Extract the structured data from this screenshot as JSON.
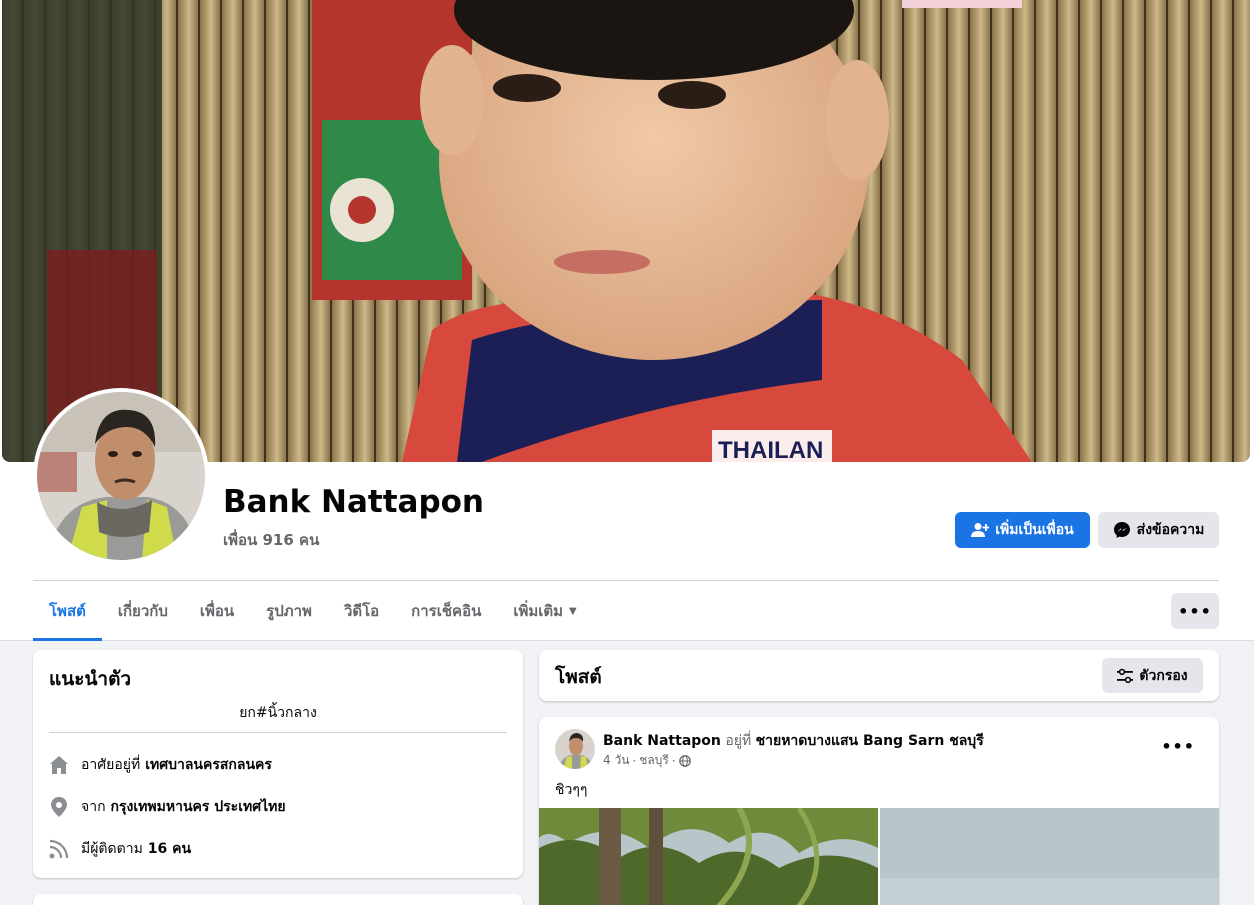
{
  "profile": {
    "name": "Bank Nattapon",
    "friends": "เพื่อน 916 คน",
    "cover_shirt_text": "THAILAN"
  },
  "actions": {
    "add_friend": "เพิ่มเป็นเพื่อน",
    "message": "ส่งข้อความ"
  },
  "tabs": [
    {
      "label": "โพสต์",
      "active": true
    },
    {
      "label": "เกี่ยวกับ"
    },
    {
      "label": "เพื่อน"
    },
    {
      "label": "รูปภาพ"
    },
    {
      "label": "วิดีโอ"
    },
    {
      "label": "การเช็คอิน"
    },
    {
      "label": "เพิ่มเติม"
    }
  ],
  "more_options": "•••",
  "intro": {
    "title": "แนะนำตัว",
    "bio": "ยก#นิ้วกลาง",
    "lives_prefix": "อาศัยอยู่ที่",
    "lives_value": "เทศบาลนครสกลนคร",
    "from_prefix": "จาก",
    "from_value": "กรุงเทพมหานคร ประเทศไทย",
    "followers_prefix": "มีผู้ติดตาม",
    "followers_value": "16 คน"
  },
  "posts": {
    "title": "โพสต์",
    "filter_label": "ตัวกรอง"
  },
  "post": {
    "author": "Bank Nattapon",
    "at_word": "อยู่ที่",
    "place": "ชายหาดบางแสน Bang Sarn ชลบุรี",
    "time": "4 วัน",
    "location": "ชลบุรี",
    "text": "ชิวๆๆ",
    "options": "•••"
  },
  "colors": {
    "accent": "#1b74e4",
    "background": "#f0f2f5",
    "secondary_button": "#e4e6eb",
    "muted_text": "#65676b"
  }
}
